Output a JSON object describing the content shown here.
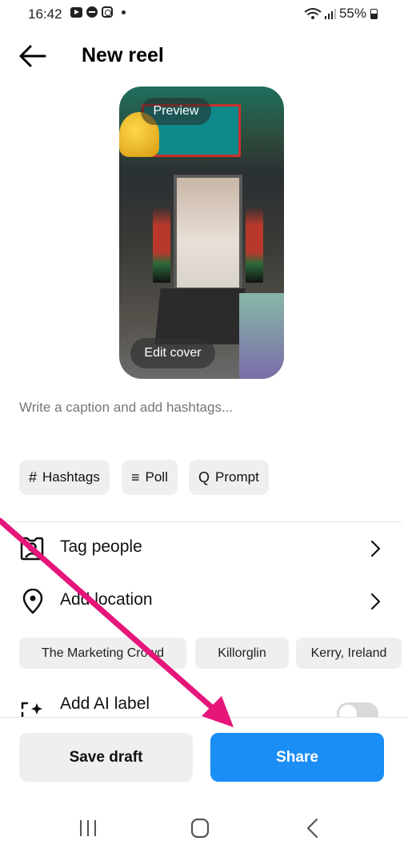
{
  "status_bar": {
    "time": "16:42",
    "battery": "55%"
  },
  "header": {
    "title": "New reel"
  },
  "preview": {
    "preview_label": "Preview",
    "edit_cover_label": "Edit cover"
  },
  "caption": {
    "placeholder": "Write a caption and add hashtags..."
  },
  "chips": [
    {
      "icon": "#",
      "label": "Hashtags"
    },
    {
      "icon": "≡",
      "label": "Poll"
    },
    {
      "icon": "Q",
      "label": "Prompt"
    }
  ],
  "rows": {
    "tag_people": "Tag people",
    "add_location": "Add location",
    "add_ai_label": "Add AI label"
  },
  "location_suggestions": [
    "The Marketing Crowd",
    "Killorglin",
    "Kerry, Ireland"
  ],
  "ai_label_enabled": false,
  "actions": {
    "save_draft": "Save draft",
    "share": "Share"
  },
  "colors": {
    "share": "#1b8ef5",
    "arrow": "#e6157a",
    "chip_bg": "#efefef"
  },
  "icons": [
    "back-arrow-icon",
    "tag-people-icon",
    "location-pin-icon",
    "chevron-right-icon",
    "ai-label-icon",
    "recents-icon",
    "home-icon",
    "back-icon"
  ]
}
